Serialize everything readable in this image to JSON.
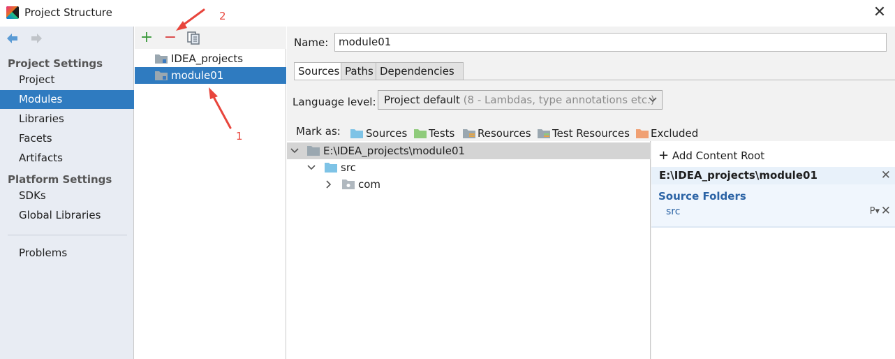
{
  "window": {
    "title": "Project Structure",
    "close_glyph": "✕"
  },
  "sidebar": {
    "project_settings_header": "Project Settings",
    "project_settings_items": [
      {
        "label": "Project"
      },
      {
        "label": "Modules",
        "selected": true
      },
      {
        "label": "Libraries"
      },
      {
        "label": "Facets"
      },
      {
        "label": "Artifacts"
      }
    ],
    "platform_settings_header": "Platform Settings",
    "platform_settings_items": [
      {
        "label": "SDKs"
      },
      {
        "label": "Global Libraries"
      }
    ],
    "problems_label": "Problems"
  },
  "modules": {
    "toolbar": {
      "add_glyph": "+",
      "remove_glyph": "−"
    },
    "items": [
      {
        "label": "IDEA_projects"
      },
      {
        "label": "module01",
        "selected": true
      }
    ]
  },
  "module_detail": {
    "name_label": "Name:",
    "name_value": "module01",
    "tabs": [
      {
        "label": "Sources",
        "active": true
      },
      {
        "label": "Paths"
      },
      {
        "label": "Dependencies"
      }
    ],
    "language_level_label": "Language level:",
    "language_level_value": "Project default",
    "language_level_hint": "(8 - Lambdas, type annotations etc.)",
    "mark_as_label": "Mark as:",
    "mark_as_options": [
      {
        "label": "Sources",
        "color": "#7ec3e6"
      },
      {
        "label": "Tests",
        "color": "#8fcb7b"
      },
      {
        "label": "Resources",
        "color": "#9aa7b0"
      },
      {
        "label": "Test Resources",
        "color": "#9aa7b0"
      },
      {
        "label": "Excluded",
        "color": "#f0a073"
      }
    ],
    "content_tree": {
      "root": "E:\\IDEA_projects\\module01",
      "children": [
        {
          "label": "src"
        },
        {
          "label": "com"
        }
      ]
    },
    "content_roots": {
      "add_label": "Add Content Root",
      "add_glyph": "+",
      "root_path": "E:\\IDEA_projects\\module01",
      "source_folders_title": "Source Folders",
      "source_folders": [
        "src"
      ],
      "props_glyph": "P▾",
      "close_glyph": "✕"
    }
  },
  "annotations": {
    "label_1": "1",
    "label_2": "2",
    "color": "#e8453c"
  },
  "colors": {
    "selection": "#2f7bc0",
    "sidebar_bg": "#e8ecf3",
    "panel_bg": "#f2f2f2",
    "source_blue": "#2b63a5"
  }
}
